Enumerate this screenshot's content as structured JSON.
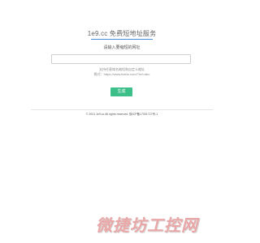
{
  "header": {
    "title": "1e9.cc 免费短地址服务",
    "subtitle": "请输入要缩短的网址"
  },
  "form": {
    "url_value": "",
    "url_placeholder": "",
    "hint_line1": "支持任意域名缩短和自定义缩址",
    "hint_line2": "格式：https://www.baidu.com/?ref=abc",
    "submit_label": "生成"
  },
  "footer": {
    "copyright": "© 2021 1e9.cc All rights reserved.",
    "beian": "陕ICP备17001727号-1"
  },
  "watermark": {
    "text": "微捷坊工控网"
  },
  "colors": {
    "accent": "#3dbf8a",
    "underline": "#4a90d9",
    "watermark": "#e9a7a7"
  }
}
